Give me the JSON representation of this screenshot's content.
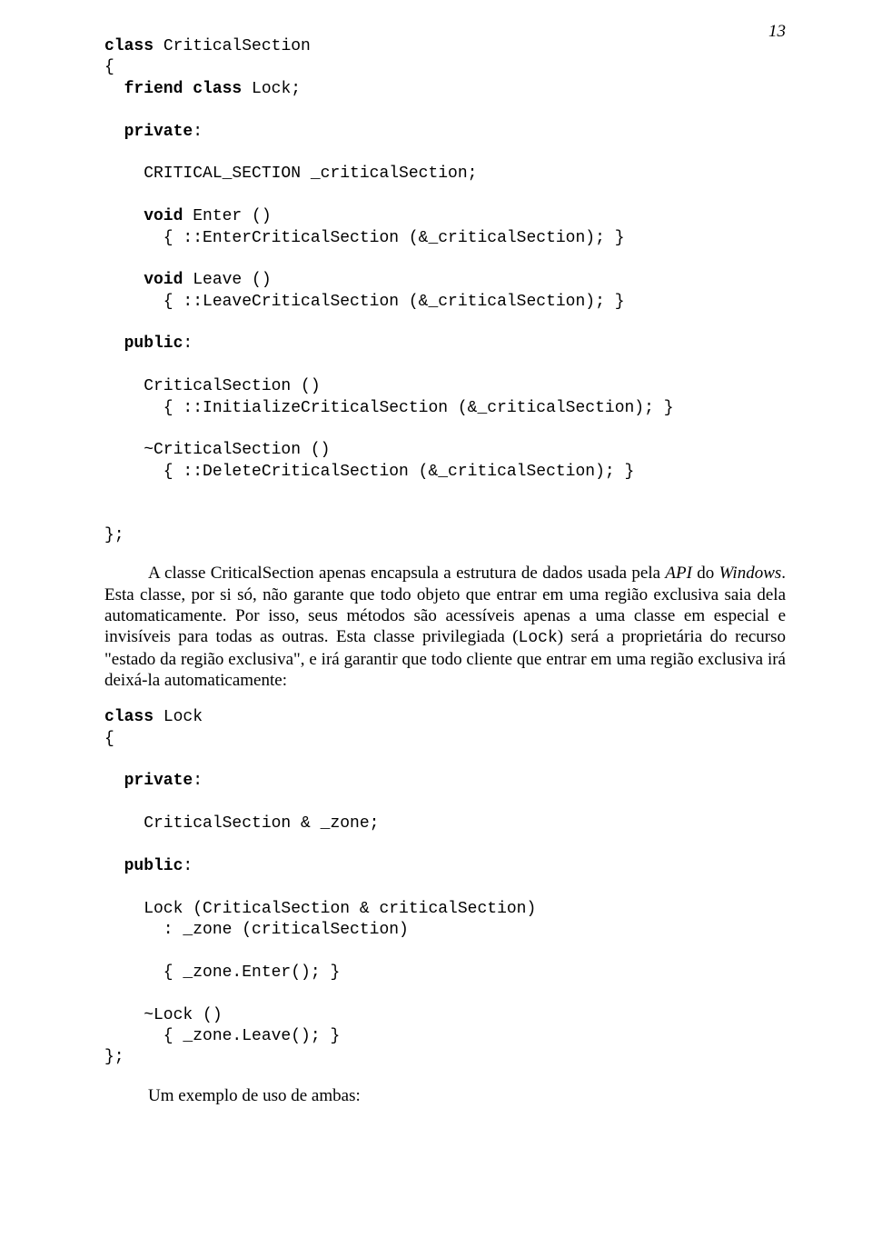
{
  "page_number": "13",
  "code1": {
    "l1a": "class",
    "l1b": " CriticalSection",
    "l2": "{",
    "l3a": "  friend class",
    "l3b": " Lock;",
    "l5a": "  private",
    "l5b": ":",
    "l7": "    CRITICAL_SECTION _criticalSection;",
    "l9a": "    void",
    "l9b": " Enter ()",
    "l10": "      { ::EnterCriticalSection (&_criticalSection); }",
    "l12a": "    void",
    "l12b": " Leave ()",
    "l13": "      { ::LeaveCriticalSection (&_criticalSection); }",
    "l15a": "  public",
    "l15b": ":",
    "l17": "    CriticalSection ()",
    "l18": "      { ::InitializeCriticalSection (&_criticalSection); }",
    "l20": "    ~CriticalSection ()",
    "l21": "      { ::DeleteCriticalSection (&_criticalSection); }",
    "l24": "};"
  },
  "para1": {
    "t1": "A classe CriticalSection apenas encapsula a estrutura de dados usada pela ",
    "t2": "API",
    "t3": " do ",
    "t4": "Windows",
    "t5": ". Esta classe, por si só, não garante que todo objeto que entrar em uma região exclusiva saia dela automaticamente. Por isso, seus métodos são acessíveis apenas a uma classe em especial e invisíveis para todas as outras. Esta classe privilegiada (",
    "t6": "Lock",
    "t7": ") será a proprietária do recurso \"estado da região exclusiva\", e irá garantir que todo cliente que entrar em uma região exclusiva irá deixá-la automaticamente:"
  },
  "code2": {
    "l1a": "class",
    "l1b": " Lock",
    "l2": "{",
    "l4a": "  private",
    "l4b": ":",
    "l6": "    CriticalSection & _zone;",
    "l8a": "  public",
    "l8b": ":",
    "l10": "    Lock (CriticalSection & criticalSection)",
    "l11": "      : _zone (criticalSection)",
    "l13": "      { _zone.Enter(); }",
    "l15": "    ~Lock ()",
    "l16": "      { _zone.Leave(); }",
    "l17": "};"
  },
  "para2": "Um exemplo de uso de ambas:"
}
